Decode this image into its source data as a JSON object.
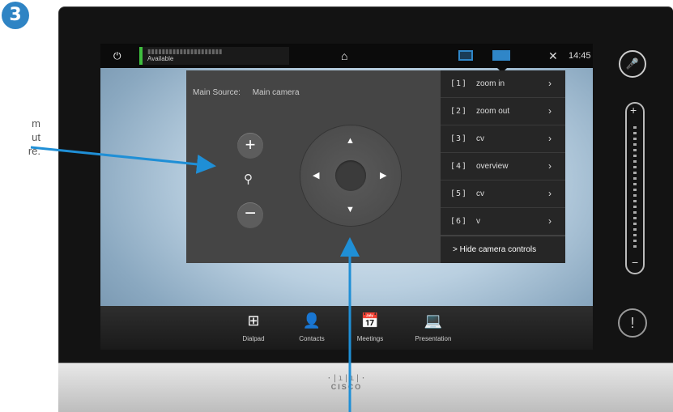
{
  "step_badge": "3",
  "note_lines": [
    "m",
    "ut",
    "re."
  ],
  "colors": {
    "accent": "#2f84c4",
    "status_green": "#3fbf3f",
    "annotation_arrow": "#1f8fd6"
  },
  "topbar": {
    "power_icon": "power-icon",
    "status_text": "Available",
    "home_icon": "home-icon",
    "selfview_icon": "selfview-icon",
    "camera_icon": "camera-icon",
    "settings_icon": "wrench-icon",
    "time": "14:45"
  },
  "camera_panel": {
    "main_source_label": "Main Source:",
    "main_source_value": "Main camera",
    "zoom_in_symbol": "+",
    "zoom_out_symbol": "−",
    "magnify_symbol": "🔍",
    "dpad": {
      "up": "▲",
      "down": "▼",
      "left": "◀",
      "right": "▶"
    },
    "presets": [
      {
        "num": "[1]",
        "label": "zoom in"
      },
      {
        "num": "[2]",
        "label": "zoom out"
      },
      {
        "num": "[3]",
        "label": "cv"
      },
      {
        "num": "[4]",
        "label": "overview"
      },
      {
        "num": "[5]",
        "label": "cv"
      },
      {
        "num": "[6]",
        "label": "v"
      }
    ],
    "chevron": "›",
    "hide_controls": "> Hide camera controls"
  },
  "dock": [
    {
      "label": "Dialpad",
      "icon": "dialpad-icon",
      "glyph": "⊞"
    },
    {
      "label": "Contacts",
      "icon": "contacts-icon",
      "glyph": "👤"
    },
    {
      "label": "Meetings",
      "icon": "calendar-icon",
      "glyph": "📅"
    },
    {
      "label": "Presentation",
      "icon": "laptop-icon",
      "glyph": "💻"
    }
  ],
  "side_controls": {
    "mute_glyph": "🎤",
    "volume_plus": "+",
    "volume_minus": "−",
    "alert_glyph": "!"
  },
  "brand": {
    "bars": "·|ı|ı|·",
    "name": "CISCO"
  }
}
